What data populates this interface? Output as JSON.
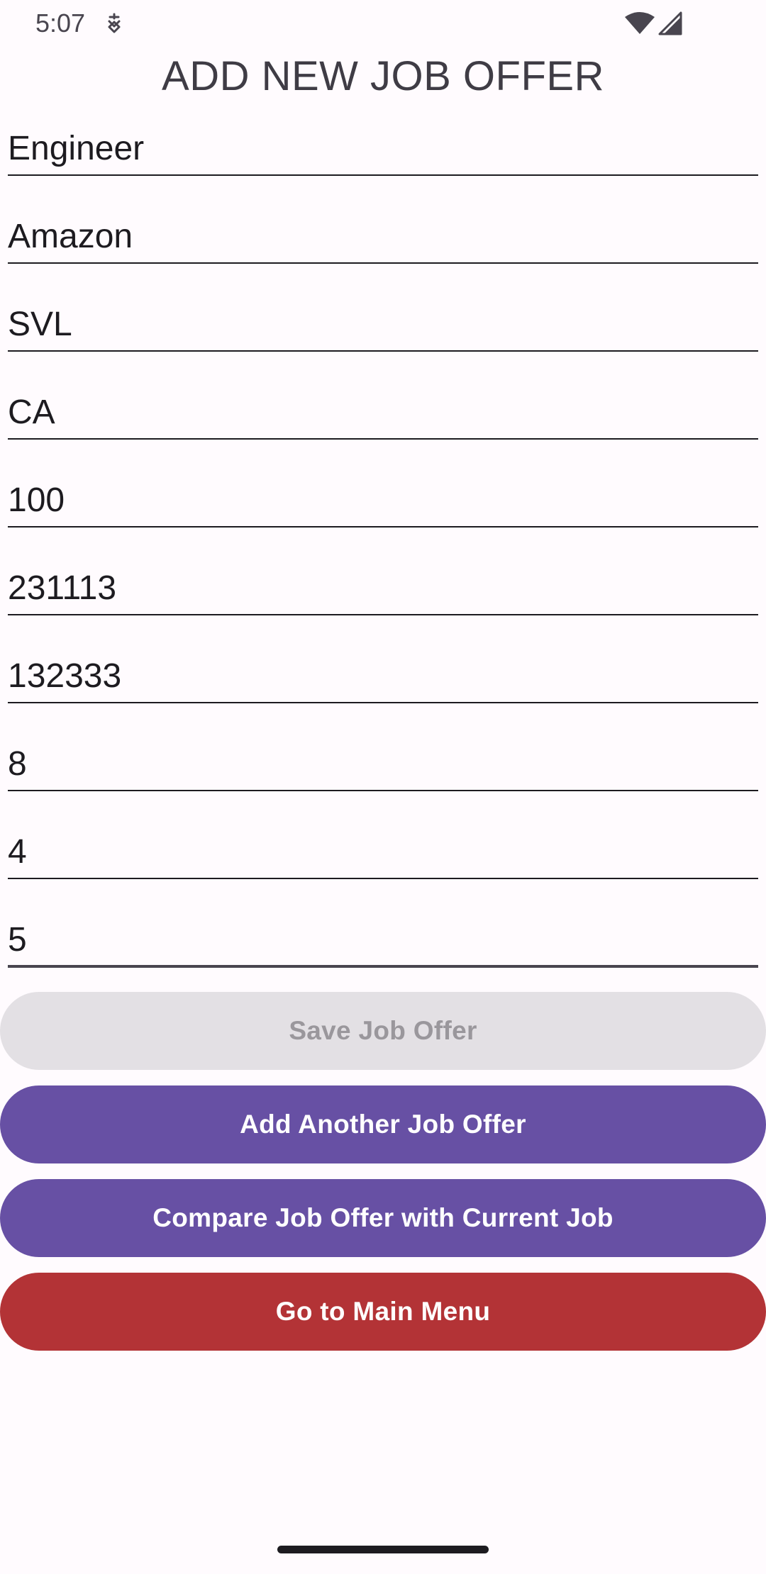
{
  "status_bar": {
    "time": "5:07",
    "icons": [
      "debug-icon",
      "wifi-icon",
      "signal-icon"
    ]
  },
  "page": {
    "title": "ADD NEW JOB OFFER"
  },
  "form": {
    "fields": [
      {
        "value": "Engineer"
      },
      {
        "value": "Amazon"
      },
      {
        "value": "SVL"
      },
      {
        "value": "CA"
      },
      {
        "value": "100"
      },
      {
        "value": "231113"
      },
      {
        "value": "132333"
      },
      {
        "value": "8"
      },
      {
        "value": "4"
      },
      {
        "value": "5"
      }
    ]
  },
  "buttons": {
    "save": "Save Job Offer",
    "add_another": "Add Another Job Offer",
    "compare": "Compare Job Offer with Current Job",
    "main_menu": "Go to Main Menu"
  },
  "colors": {
    "background": "#fffbfe",
    "primary": "#6750a4",
    "danger": "#b33336",
    "disabled_bg": "#e3e0e4",
    "disabled_text": "#9a979c"
  }
}
